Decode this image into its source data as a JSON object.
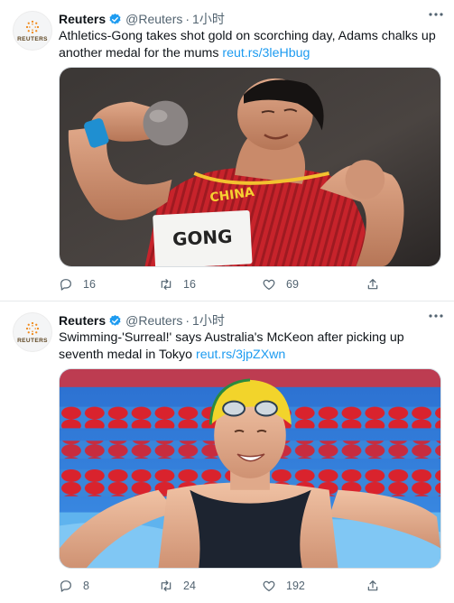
{
  "tweets": [
    {
      "author_name": "Reuters",
      "handle": "@Reuters",
      "separator": "·",
      "time": "1小时",
      "avatar_text": "REUTERS",
      "text": "Athletics-Gong takes shot gold on scorching day, Adams chalks up another medal for the mums",
      "link": "reut.rs/3leHbug",
      "bib": "GONG",
      "replies": "16",
      "retweets": "16",
      "likes": "69"
    },
    {
      "author_name": "Reuters",
      "handle": "@Reuters",
      "separator": "·",
      "time": "1小时",
      "avatar_text": "REUTERS",
      "text": "Swimming-'Surreal!' says Australia's McKeon after picking up seventh medal in Tokyo",
      "link": "reut.rs/3jpZXwn",
      "replies": "8",
      "retweets": "24",
      "likes": "192"
    }
  ],
  "colors": {
    "link": "#1d9bf0",
    "verified": "#1d9bf0",
    "muted": "#536471"
  },
  "icons": [
    "reuters-logo-icon",
    "verified-badge-icon",
    "more-icon",
    "reply-icon",
    "retweet-icon",
    "like-icon",
    "share-icon"
  ]
}
